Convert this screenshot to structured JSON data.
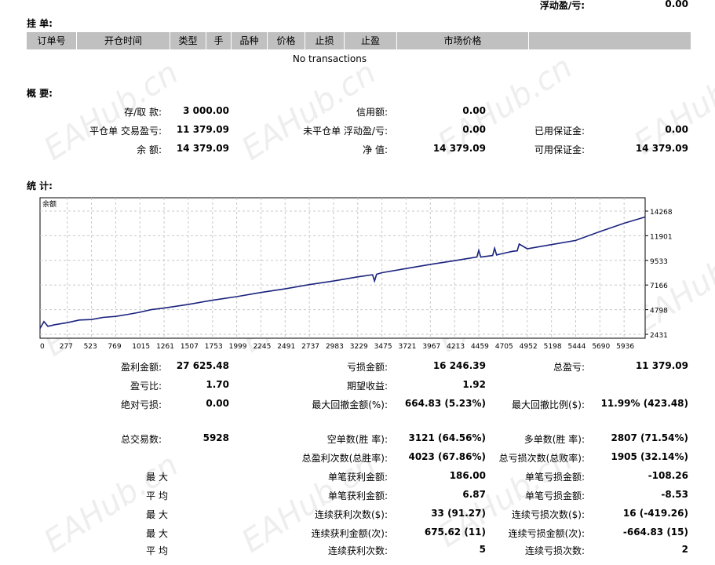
{
  "top": {
    "floating_label": "浮动盈/亏:",
    "floating_value": "0.00"
  },
  "orders": {
    "title": "挂 单:",
    "columns": [
      "订单号",
      "开仓时间",
      "类型",
      "手",
      "品种",
      "价格",
      "止损",
      "止盈",
      "市场价格",
      ""
    ],
    "empty_text": "No transactions"
  },
  "summary": {
    "title": "概 要:",
    "deposit_label": "存/取 款:",
    "deposit_value": "3 000.00",
    "credit_label": "信用额:",
    "credit_value": "0.00",
    "closed_pl_label": "平仓单 交易盈亏:",
    "closed_pl_value": "11 379.09",
    "open_pl_label": "未平仓单 浮动盈/亏:",
    "open_pl_value": "0.00",
    "margin_label": "已用保证金:",
    "margin_value": "0.00",
    "balance_label": "余 额:",
    "balance_value": "14 379.09",
    "equity_label": "净 值:",
    "equity_value": "14 379.09",
    "free_margin_label": "可用保证金:",
    "free_margin_value": "14 379.09"
  },
  "stats_title": "统 计:",
  "watermark": "EAHub.cn",
  "chart_data": {
    "type": "line",
    "title": "余额",
    "x_ticks": [
      "0",
      "277",
      "523",
      "769",
      "1015",
      "1261",
      "1507",
      "1753",
      "1999",
      "2245",
      "2491",
      "2737",
      "2983",
      "3229",
      "3475",
      "3721",
      "3967",
      "4213",
      "4459",
      "4705",
      "4952",
      "5198",
      "5444",
      "5690",
      "5936"
    ],
    "y_ticks": [
      "14268",
      "11901",
      "9533",
      "7166",
      "4798",
      "2431"
    ],
    "xlim": [
      0,
      6150
    ],
    "ylim": [
      2431,
      14268
    ],
    "grid": true,
    "colors": {
      "line": "#1a237e",
      "grid": "#c8c8c8"
    },
    "series": [
      {
        "x": [
          0,
          40,
          80,
          150,
          277,
          400,
          523,
          640,
          769,
          900,
          1015,
          1130,
          1261,
          1507,
          1753,
          1999,
          2245,
          2491,
          2737,
          2983,
          3229,
          3380,
          3400,
          3420,
          3475,
          3721,
          3967,
          4213,
          4340,
          4440,
          4459,
          4480,
          4600,
          4620,
          4640,
          4705,
          4800,
          4850,
          4870,
          4952,
          5198,
          5444,
          5690,
          5936,
          6150
        ],
        "y": [
          3000,
          3650,
          3200,
          3350,
          3550,
          3800,
          3850,
          4050,
          4150,
          4350,
          4550,
          4800,
          4950,
          5300,
          5700,
          6050,
          6450,
          6800,
          7200,
          7550,
          7950,
          8150,
          7550,
          8200,
          8350,
          8750,
          9150,
          9500,
          9700,
          9850,
          10500,
          9850,
          10000,
          10700,
          10050,
          10200,
          10400,
          10450,
          11100,
          10650,
          11050,
          11450,
          12300,
          13100,
          13700
        ]
      }
    ]
  },
  "stats": {
    "gross_profit_label": "盈利金额:",
    "gross_profit_value": "27 625.48",
    "gross_loss_label": "亏损金额:",
    "gross_loss_value": "16 246.39",
    "total_net_label": "总盈亏:",
    "total_net_value": "11 379.09",
    "profit_factor_label": "盈亏比:",
    "profit_factor_value": "1.70",
    "expected_payoff_label": "期望收益:",
    "expected_payoff_value": "1.92",
    "abs_drawdown_label": "绝对亏损:",
    "abs_drawdown_value": "0.00",
    "max_drawdown_label": "最大回撤金额(%):",
    "max_drawdown_value": "664.83 (5.23%)",
    "rel_drawdown_label": "最大回撤比例($):",
    "rel_drawdown_value": "11.99% (423.48)",
    "total_trades_label": "总交易数:",
    "total_trades_value": "5928",
    "short_label": "空单数(胜 率):",
    "short_value": "3121 (64.56%)",
    "long_label": "多单数(胜 率):",
    "long_value": "2807 (71.54%)",
    "profit_trades_label": "总盈利次数(总胜率):",
    "profit_trades_value": "4023 (67.86%)",
    "loss_trades_label": "总亏损次数(总败率):",
    "loss_trades_value": "1905 (32.14%)",
    "max1_label": "最 大",
    "largest_profit_label": "单笔获利金额:",
    "largest_profit_value": "186.00",
    "largest_loss_label": "单笔亏损金额:",
    "largest_loss_value": "-108.26",
    "avg1_label": "平 均",
    "avg_profit_label": "单笔获利金额:",
    "avg_profit_value": "6.87",
    "avg_loss_label": "单笔亏损金额:",
    "avg_loss_value": "-8.53",
    "max2_label": "最 大",
    "cons_wins_label": "连续获利次数($):",
    "cons_wins_value": "33 (91.27)",
    "cons_losses_label": "连续亏损次数($):",
    "cons_losses_value": "16 (-419.26)",
    "max3_label": "最 大",
    "cons_profit_label": "连续获利金额(次):",
    "cons_profit_value": "675.62 (11)",
    "cons_loss_label": "连续亏损金额(次):",
    "cons_loss_value": "-664.83 (15)",
    "avg2_label": "平 均",
    "avg_cons_wins_label": "连续获利次数:",
    "avg_cons_wins_value": "5",
    "avg_cons_losses_label": "连续亏损次数:",
    "avg_cons_losses_value": "2"
  }
}
